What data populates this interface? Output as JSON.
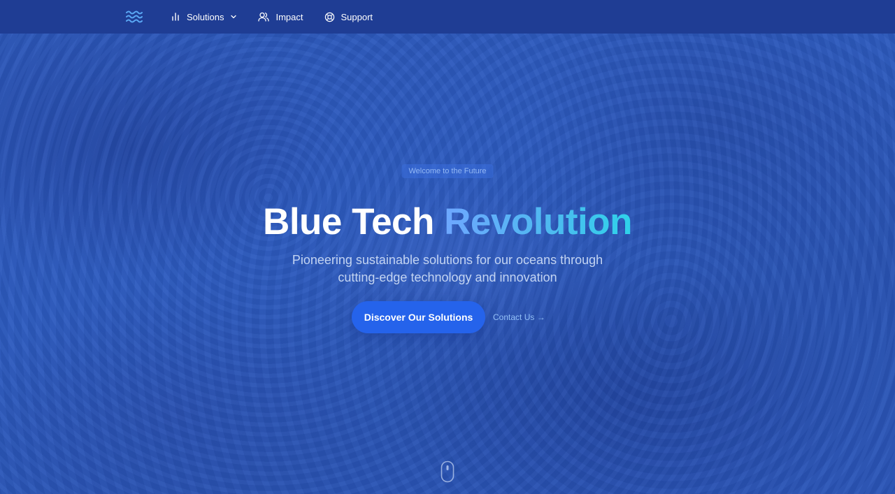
{
  "nav": {
    "items": [
      {
        "label": "Solutions",
        "icon": "bar-chart-icon",
        "has_dropdown": true
      },
      {
        "label": "Impact",
        "icon": "users-icon"
      },
      {
        "label": "Support",
        "icon": "lifebuoy-icon"
      }
    ],
    "logo_icon": "waves-icon"
  },
  "hero": {
    "badge": "Welcome to the Future",
    "title_part1": "Blue Tech",
    "title_part2": "Revolution",
    "subtitle_line1": "Pioneering sustainable solutions for our oceans through",
    "subtitle_line2": "cutting-edge technology and innovation",
    "primary_cta": "Discover Our Solutions",
    "secondary_cta": "Contact Us →",
    "scroll_icon": "mouse-icon"
  },
  "colors": {
    "nav_bg": "#1f3d94",
    "primary_button": "#2563eb",
    "accent_gradient_start": "#6ea7ff",
    "accent_gradient_end": "#2ed3ea",
    "badge_text": "#93b8f5"
  }
}
